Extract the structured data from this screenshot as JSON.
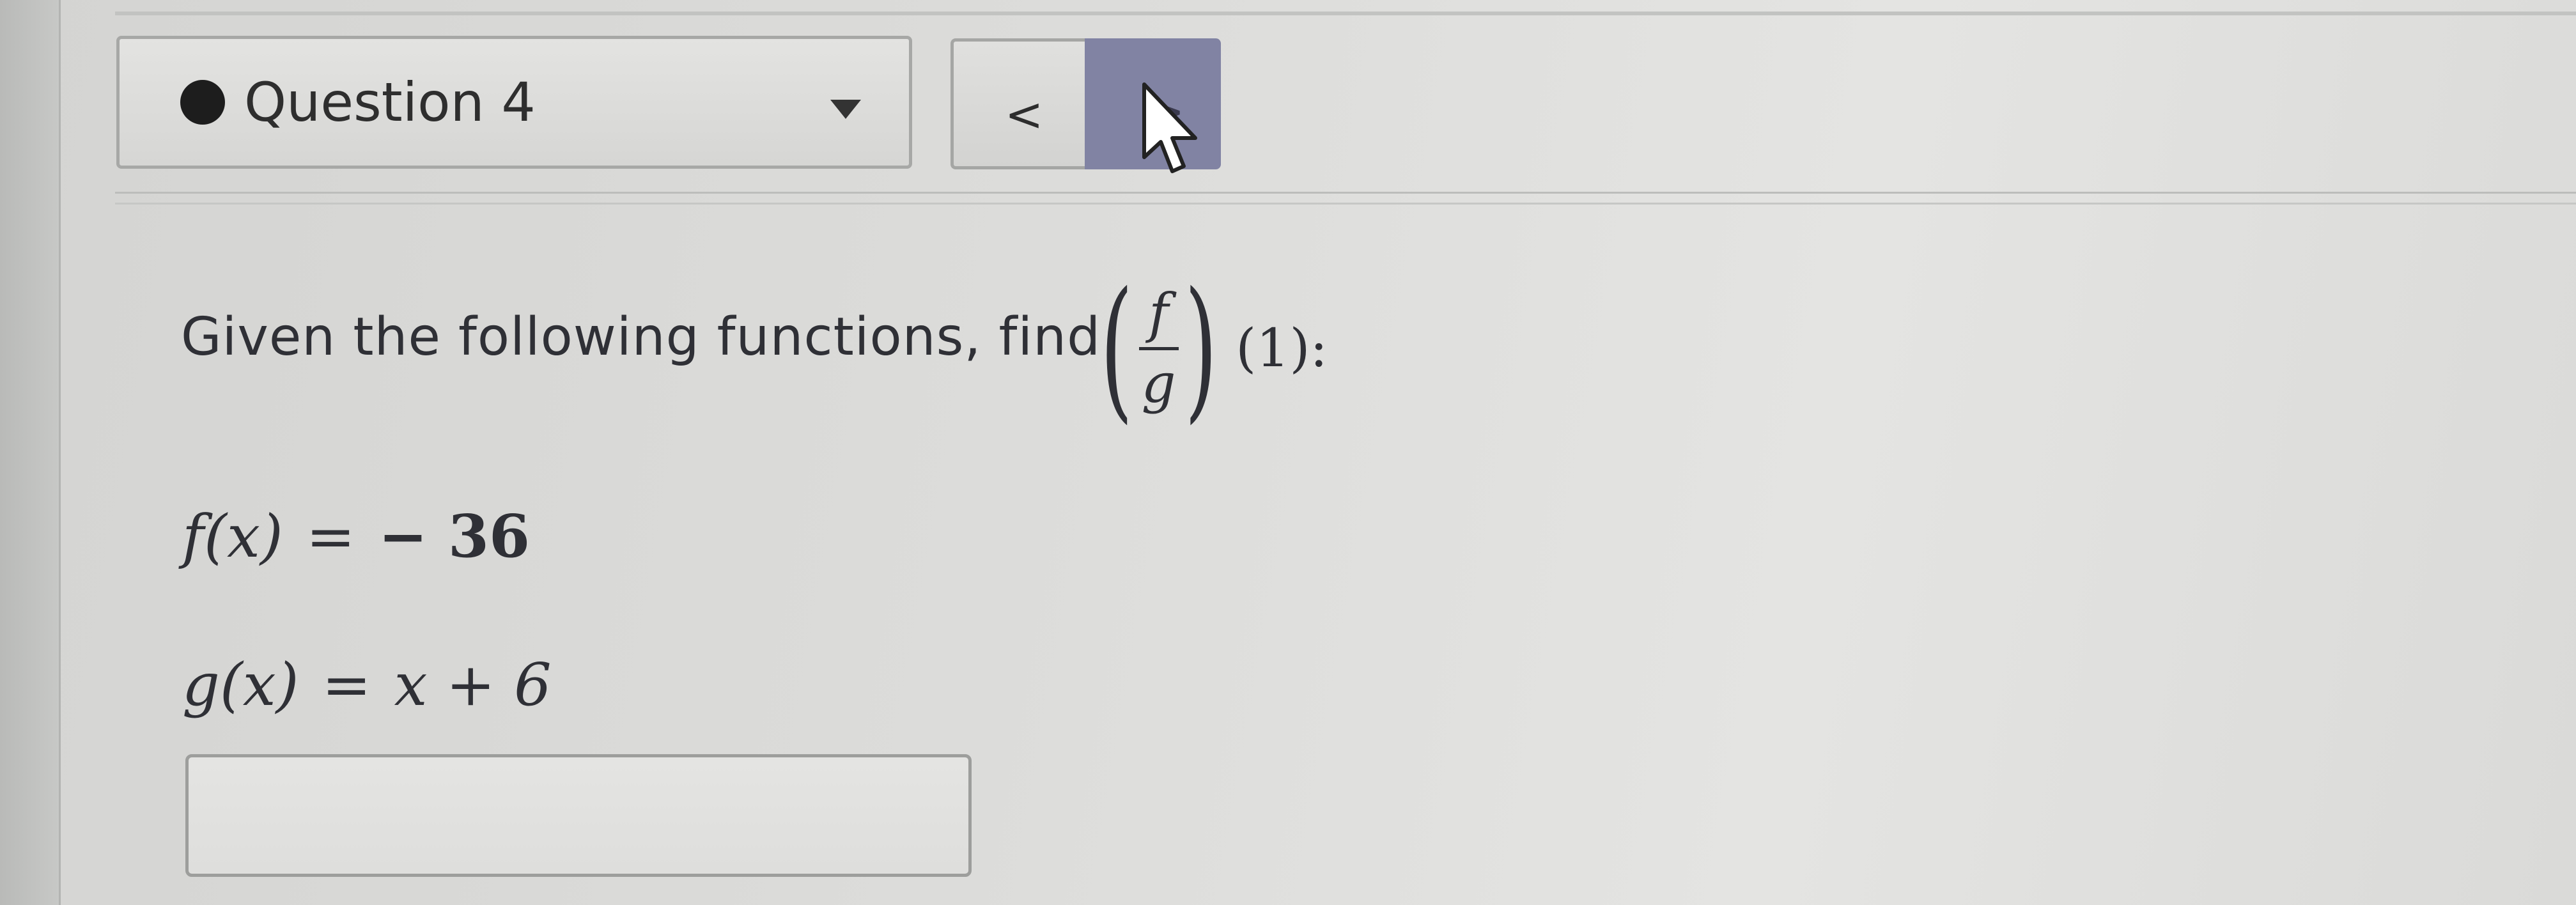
{
  "question_nav": {
    "selected_question": "Question 4",
    "prev_label": "<",
    "next_label": ">"
  },
  "question": {
    "prompt": "Given the following functions, find",
    "expression": {
      "numerator": "f",
      "denominator": "g",
      "argument": "(1):"
    },
    "equations": [
      {
        "lhs": "f(x)",
        "sign": "=",
        "rhs": "− 36"
      },
      {
        "lhs": "g(x)",
        "sign": "=",
        "rhs": "x + 6"
      }
    ]
  },
  "answer": {
    "value": "",
    "placeholder": ""
  },
  "colors": {
    "next_button": "#8183a3",
    "status_dot": "#1d1d1d",
    "text": "#2f3036"
  }
}
